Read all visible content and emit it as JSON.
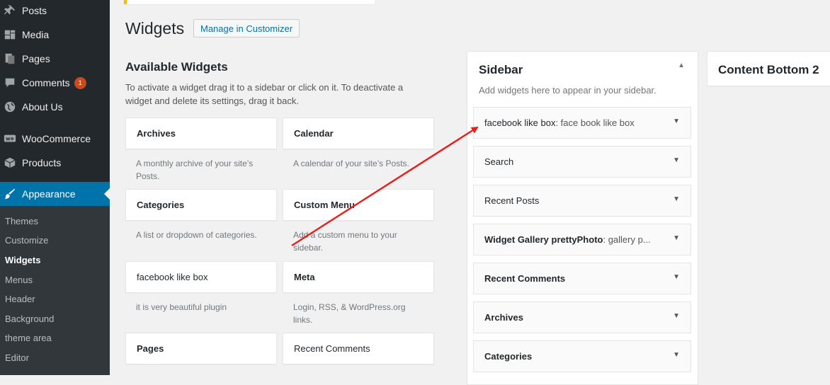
{
  "menu": {
    "posts": "Posts",
    "media": "Media",
    "pages": "Pages",
    "comments": "Comments",
    "comments_badge": "1",
    "about": "About Us",
    "woocommerce": "WooCommerce",
    "products": "Products",
    "appearance": "Appearance"
  },
  "submenu": {
    "themes": "Themes",
    "customize": "Customize",
    "widgets": "Widgets",
    "menus": "Menus",
    "header": "Header",
    "background": "Background",
    "theme_area": "theme area",
    "editor": "Editor"
  },
  "page": {
    "title": "Widgets",
    "customizer_button": "Manage in Customizer"
  },
  "available": {
    "title": "Available Widgets",
    "description": "To activate a widget drag it to a sidebar or click on it. To deactivate a widget and delete its settings, drag it back.",
    "widgets": [
      {
        "title": "Archives",
        "desc": "A monthly archive of your site’s Posts."
      },
      {
        "title": "Calendar",
        "desc": "A calendar of your site’s Posts."
      },
      {
        "title": "Categories",
        "desc": "A list or dropdown of categories."
      },
      {
        "title": "Custom Menu",
        "desc": "Add a custom menu to your sidebar."
      },
      {
        "title": "facebook like box",
        "desc": "it is very beautiful plugin"
      },
      {
        "title": "Meta",
        "desc": "Login, RSS, & WordPress.org links."
      },
      {
        "title": "Pages",
        "desc": ""
      },
      {
        "title": "Recent Comments",
        "desc": ""
      }
    ]
  },
  "sidebar": {
    "title": "Sidebar",
    "description": "Add widgets here to appear in your sidebar.",
    "widgets": [
      {
        "title": "facebook like box",
        "subtitle": ": face book like box"
      },
      {
        "title": "Search",
        "subtitle": ""
      },
      {
        "title": "Recent Posts",
        "subtitle": ""
      },
      {
        "title": "Widget Gallery prettyPhoto",
        "subtitle": ": gallery p..."
      },
      {
        "title": "Recent Comments",
        "subtitle": ""
      },
      {
        "title": "Archives",
        "subtitle": ""
      },
      {
        "title": "Categories",
        "subtitle": ""
      }
    ]
  },
  "content_bottom": {
    "title": "Content Bottom 2"
  },
  "colors": {
    "admin_bar": "#23282d",
    "active": "#0073aa",
    "badge": "#ca4a1f",
    "arrow": "#e8201c"
  },
  "icons": {
    "posts": "pushpin-icon",
    "media": "media-icon",
    "pages": "pages-icon",
    "comments": "comment-icon",
    "about": "globe-icon",
    "woocommerce": "woocommerce-icon",
    "products": "box-icon",
    "appearance": "paintbrush-icon"
  }
}
